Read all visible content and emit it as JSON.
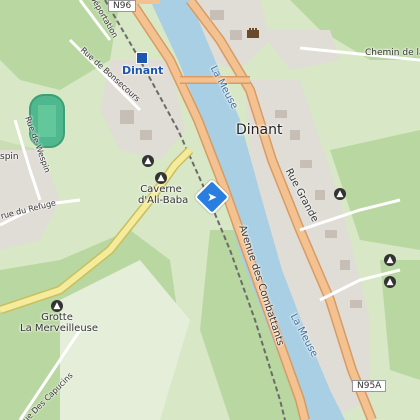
{
  "map": {
    "colors": {
      "forest": "#b9d7a0",
      "meadow": "#d8e8c6",
      "urban": "#e0dcd6",
      "water": "#a8cfe4",
      "main_road": "#f4c290",
      "road_casing": "#d79b63",
      "minor_road": "#ffffff",
      "rail": "#6b6b6b",
      "pitch": "#4fb88e",
      "building": "#c7bfb6"
    },
    "labels": {
      "town": "Dinant",
      "town_blue": "Dinant",
      "river_north": "La Meuse",
      "river_south": "La Meuse",
      "rue_grande": "Rue Grande",
      "avenue_combattants": "Avenue des Combattants",
      "rue_bonsecours": "Rue de Bonsecours",
      "rue_refuge": "rue du Refuge",
      "rue_wespin": "Rue de Wespin",
      "rue_deportation": "Déportation",
      "rue_capucins": "Rue Des Capucins",
      "chemin": "Chemin de la C",
      "wespin_partial": "spin",
      "road_n96": "N96",
      "road_n95a": "N95A"
    },
    "pois": {
      "caverne_line1": "Caverne",
      "caverne_line2": "d'Ali-Baba",
      "grotte_line1": "Grotte",
      "grotte_line2": "La Merveilleuse"
    },
    "icons": [
      "cave-icon",
      "castle-icon",
      "directions-icon",
      "station-icon"
    ]
  }
}
